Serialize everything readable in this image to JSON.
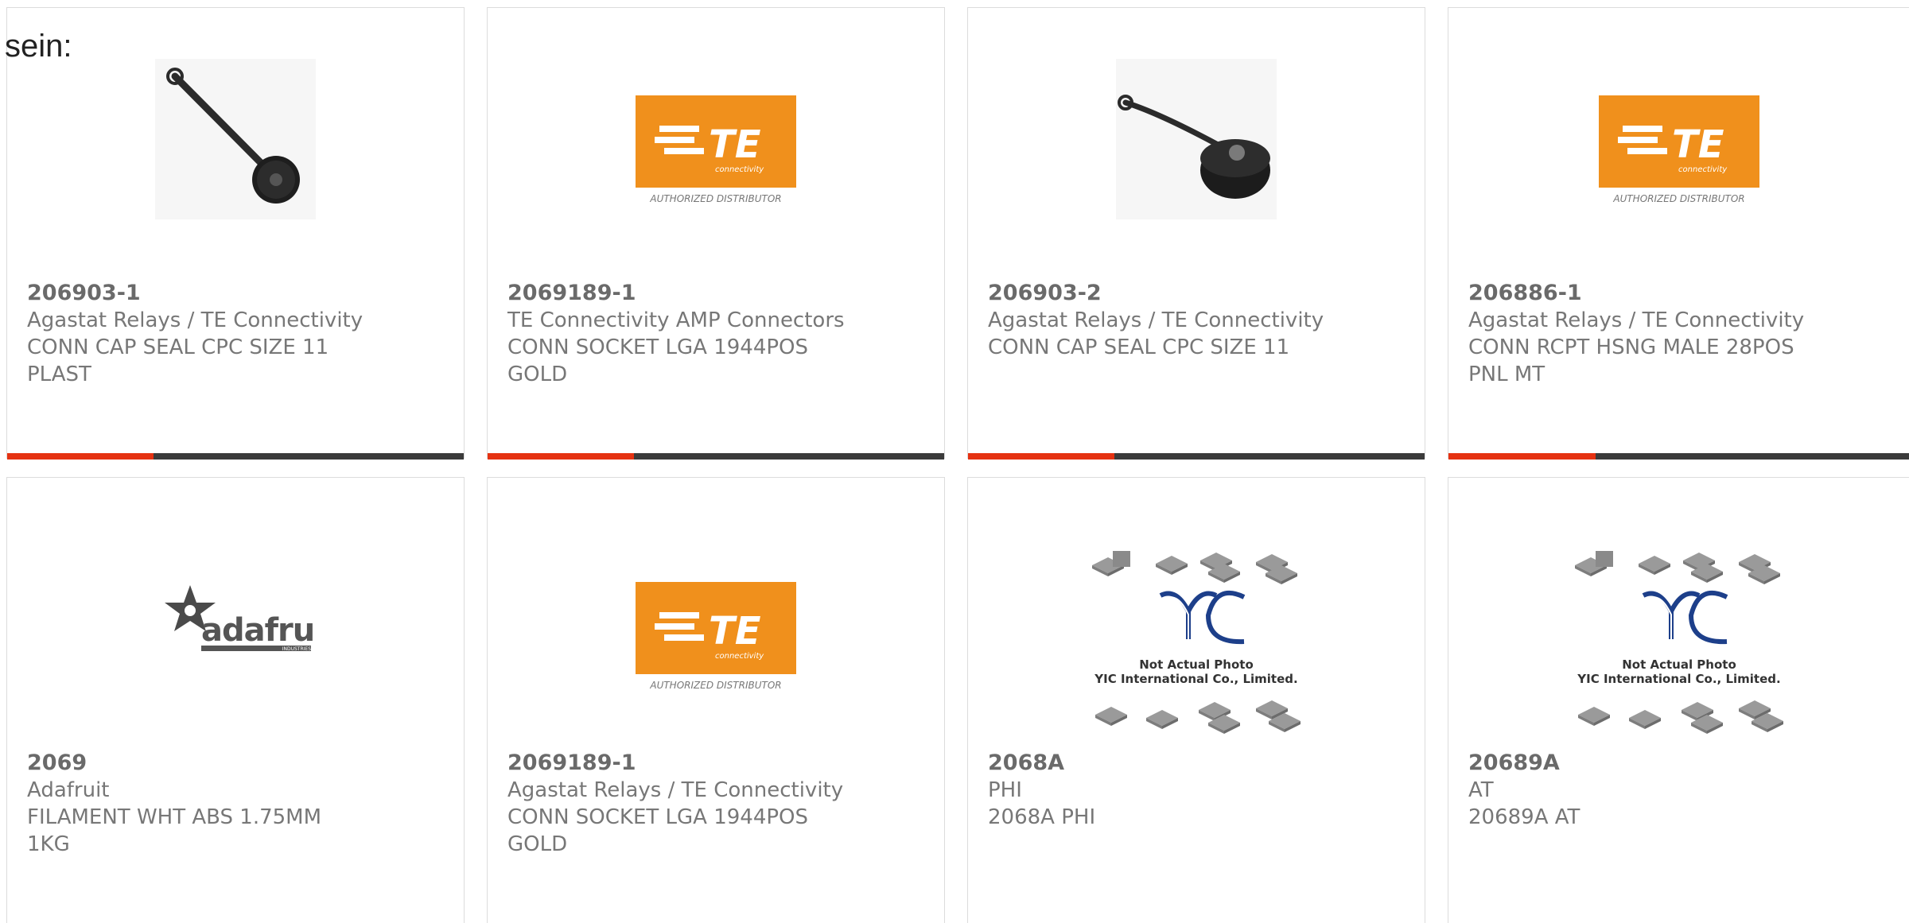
{
  "intro_text": "sein:",
  "colors": {
    "bar_dark": "#3b3b3b",
    "bar_accent": "#e53212",
    "te_orange": "#f0901c",
    "card_border": "#dcdcdc",
    "text_grey": "#777777"
  },
  "te_logo": {
    "wordmark": "TE",
    "sub": "connectivity",
    "caption": "AUTHORIZED DISTRIBUTOR"
  },
  "adafruit_logo": {
    "wordmark": "adafruit",
    "sub": "INDUSTRIES"
  },
  "yic_image": {
    "logo": "YIC",
    "line1": "Not Actual Photo",
    "line2": "YIC International Co., Limited."
  },
  "products": [
    {
      "part_number": "206903-1",
      "manufacturer": "Agastat Relays / TE Connectivity",
      "description": "CONN CAP SEAL CPC SIZE 11 PLAST",
      "image": "cap-seal-photo-icon",
      "progress": 0.32
    },
    {
      "part_number": "2069189-1",
      "manufacturer": "TE Connectivity AMP Connectors",
      "description": "CONN SOCKET LGA 1944POS GOLD",
      "image": "te-connectivity-logo",
      "progress": 0.32
    },
    {
      "part_number": "206903-2",
      "manufacturer": "Agastat Relays / TE Connectivity",
      "description": "CONN CAP SEAL CPC SIZE 11",
      "image": "cap-seal-photo-icon",
      "progress": 0.32
    },
    {
      "part_number": "206886-1",
      "manufacturer": "Agastat Relays / TE Connectivity",
      "description": "CONN RCPT HSNG MALE 28POS PNL MT",
      "image": "te-connectivity-logo",
      "progress": 0.32
    },
    {
      "part_number": "2069",
      "manufacturer": "Adafruit",
      "description": "FILAMENT WHT ABS 1.75MM 1KG",
      "image": "adafruit-logo"
    },
    {
      "part_number": "2069189-1",
      "manufacturer": "Agastat Relays / TE Connectivity",
      "description": "CONN SOCKET LGA 1944POS GOLD",
      "image": "te-connectivity-logo"
    },
    {
      "part_number": "2068A",
      "manufacturer": "PHI",
      "description": "2068A PHI",
      "image": "yic-not-actual-photo"
    },
    {
      "part_number": "20689A",
      "manufacturer": "AT",
      "description": "20689A AT",
      "image": "yic-not-actual-photo"
    }
  ]
}
